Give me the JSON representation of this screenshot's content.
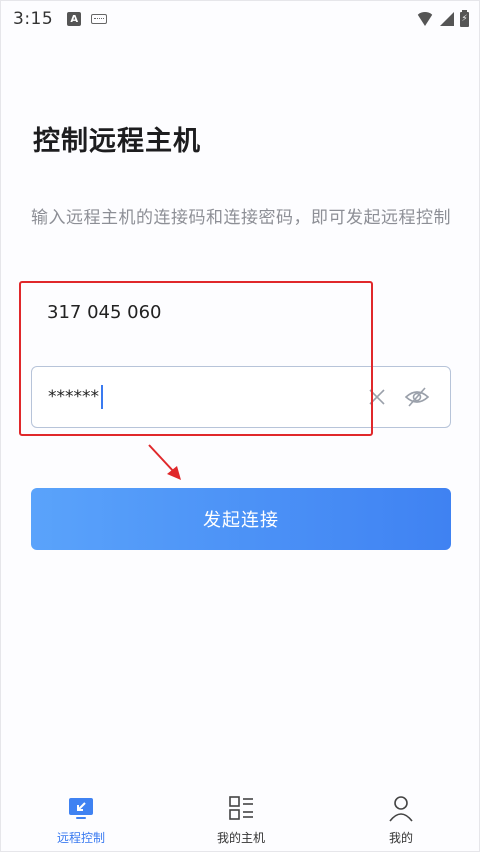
{
  "status_bar": {
    "time": "3:15",
    "indicator_letter": "A"
  },
  "main": {
    "title": "控制远程主机",
    "description": "输入远程主机的连接码和连接密码，即可发起远程控制",
    "connection_code": "317 045 060",
    "password_value": "******",
    "connect_button_label": "发起连接"
  },
  "tabs": [
    {
      "label": "远程控制",
      "icon": "remote-control-icon",
      "active": true
    },
    {
      "label": "我的主机",
      "icon": "host-list-icon",
      "active": false
    },
    {
      "label": "我的",
      "icon": "profile-icon",
      "active": false
    }
  ],
  "colors": {
    "accent": "#3f82f2",
    "annotation": "#e0282b"
  }
}
